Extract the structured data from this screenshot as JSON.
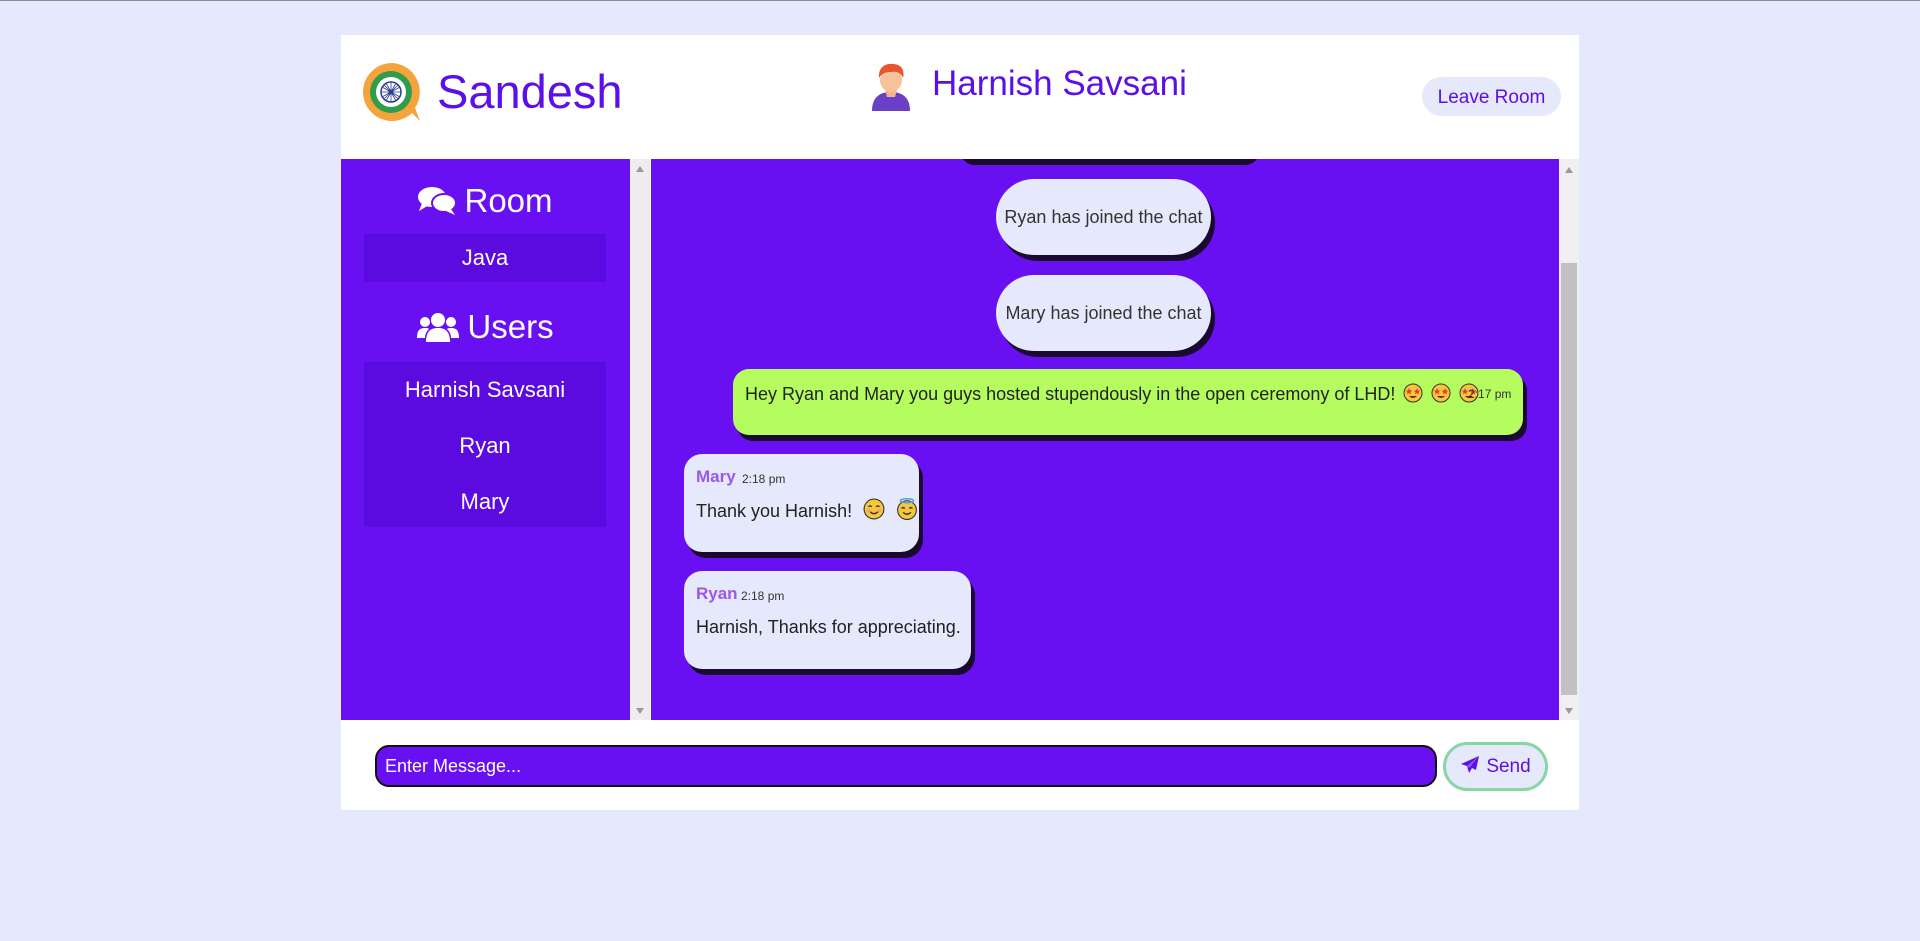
{
  "header": {
    "brand": "Sandesh",
    "current_user": "Harnish Savsani",
    "leave_label": "Leave Room"
  },
  "sidebar": {
    "room_heading": "Room",
    "room_icon": "comments-icon",
    "room_name": "Java",
    "users_heading": "Users",
    "users_icon": "users-icon",
    "users": [
      "Harnish Savsani",
      "Ryan",
      "Mary"
    ]
  },
  "chat": {
    "notifications": [
      "Ryan has joined the chat",
      "Mary has joined the chat"
    ],
    "messages": [
      {
        "sender": "",
        "time": "2:17 pm",
        "text": "Hey Ryan and Mary you guys hosted stupendously in the open ceremony of LHD!",
        "emojis": [
          "star-struck-emoji",
          "star-struck-emoji",
          "star-struck-emoji"
        ],
        "own": true
      },
      {
        "sender": "Mary",
        "time": "2:18 pm",
        "text": "Thank you Harnish!",
        "emojis": [
          "smiling-emoji",
          "halo-emoji"
        ],
        "own": false
      },
      {
        "sender": "Ryan",
        "time": "2:18 pm",
        "text": "Harnish, Thanks for appreciating.",
        "emojis": [],
        "own": false
      }
    ]
  },
  "composer": {
    "placeholder": "Enter Message...",
    "send_label": "Send",
    "send_icon": "paper-plane-icon"
  },
  "colors": {
    "page_bg": "#e6e8fc",
    "accent": "#6910f2",
    "brand_text": "#5b10e8",
    "own_bubble": "#b5fd5e",
    "other_bubble": "#e6e8fc",
    "sender_name": "#9a58e8"
  }
}
